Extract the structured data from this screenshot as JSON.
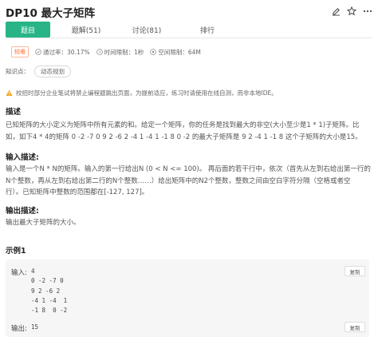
{
  "header": {
    "title": "DP10 最大子矩阵"
  },
  "tabs": [
    {
      "label": "题目"
    },
    {
      "label": "题解(51)"
    },
    {
      "label": "讨论(81)"
    },
    {
      "label": "排行"
    }
  ],
  "meta": {
    "difficulty": "较难",
    "pass_rate": "通过率：30.17%",
    "time_limit": "时间限制：1秒",
    "space_limit": "空间限制：64M"
  },
  "knowledge": {
    "label": "知识点：",
    "tag": "动态规划"
  },
  "warning": "校招时部分企业笔试将禁止编程题跳出页面，为提前适应，练习时请使用在线自测，而非本地IDE。",
  "description": {
    "title": "描述",
    "line1": "已知矩阵的大小定义为矩阵中所有元素的和。给定一个矩阵，你的任务是找到最大的非空(大小至少是1 * 1)子矩阵。比",
    "line2": "如，如下4 * 4的矩阵 0 -2 -7 0 9 2 -6 2 -4 1 -4 1 -1 8 0 -2 的最大子矩阵是 9 2 -4 1 -1 8 这个子矩阵的大小是15。"
  },
  "input_desc": {
    "title": "输入描述:",
    "line1": "输入是一个N * N的矩阵。输入的第一行给出N (0 < N <= 100)。 再后面的若干行中，依次（首先从左到右给出第一行的",
    "line2": "N个整数，再从左到右给出第二行的N个整数……）给出矩阵中的N2个整数，整数之间由空白字符分隔（空格或者空",
    "line3": "行）。已知矩阵中整数的范围都在[-127, 127]。"
  },
  "output_desc": {
    "title": "输出描述:",
    "line1": "输出最大子矩阵的大小。"
  },
  "example": {
    "title": "示例1",
    "input_label": "输入:",
    "input_value": "4\n0 -2 -7 0\n9 2 -6 2\n-4 1 -4  1\n-1 8  0 -2",
    "output_label": "输出:",
    "output_value": "15",
    "copy_label": "复制"
  },
  "colors": {
    "accent": "#29b487",
    "difficulty": "#ff6a2b",
    "warning_icon": "#f5a623"
  }
}
